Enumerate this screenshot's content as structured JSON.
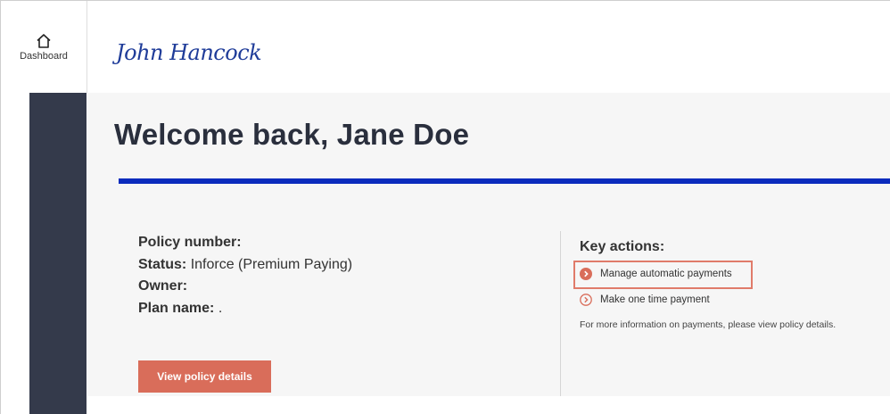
{
  "sidebar": {
    "dashboard_label": "Dashboard"
  },
  "header": {
    "logo_text": "John Hancock"
  },
  "main": {
    "welcome": "Welcome back, Jane Doe",
    "policy": {
      "number_label": "Policy number:",
      "status_label": "Status:",
      "status_value": "Inforce (Premium Paying)",
      "owner_label": "Owner:",
      "plan_label": "Plan name:",
      "plan_value": "."
    },
    "view_button": "View policy details",
    "key_actions": {
      "title": "Key actions:",
      "items": [
        "Manage automatic payments",
        "Make one time payment"
      ],
      "info": "For more information on payments, please view policy details."
    }
  },
  "colors": {
    "brand_blue": "#0b2bbd",
    "logo_blue": "#1f3c99",
    "sidebar_dark": "#343a4b",
    "accent_coral": "#d96d5a"
  },
  "icons": [
    "home-icon",
    "chevron-circle-filled-icon",
    "chevron-circle-outline-icon"
  ]
}
